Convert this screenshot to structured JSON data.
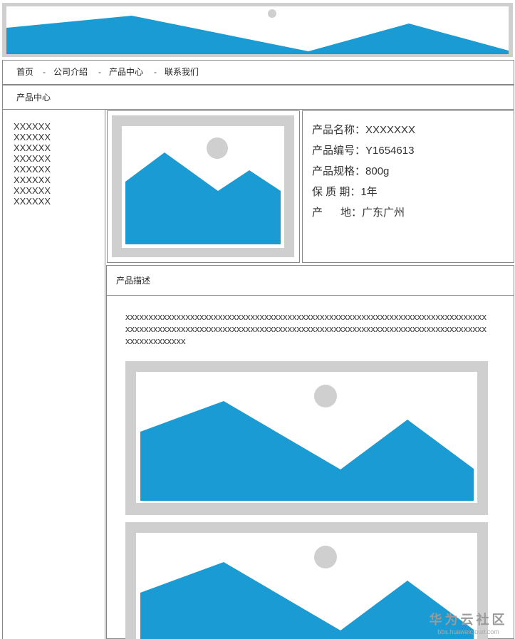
{
  "nav": {
    "items": [
      "首页",
      "公司介绍",
      "产品中心",
      "联系我们"
    ],
    "separator": "-"
  },
  "breadcrumb": {
    "label": "产品中心"
  },
  "sidebar": {
    "items": [
      "XXXXXX",
      "XXXXXX",
      "XXXXXX",
      "XXXXXX",
      "XXXXXX",
      "XXXXXX",
      "XXXXXX",
      "XXXXXX"
    ]
  },
  "product": {
    "name_label": "产品名称：",
    "name": "XXXXXXX",
    "code_label": "产品编号：",
    "code": "Y1654613",
    "spec_label": "产品规格：",
    "spec": "800g",
    "shelf_label": "保 质 期：",
    "shelf": "1年",
    "origin_label": "产      地：",
    "origin": "广东广州"
  },
  "description": {
    "heading": "产品描述",
    "text": "xxxxxxxxxxxxxxxxxxxxxxxxxxxxxxxxxxxxxxxxxxxxxxxxxxxxxxxxxxxxxxxxxxxxxxxxxxxxxxxxxxxxxxxxxxxxxxxxxxxxxxxxxxxxxxxxxxxxxxxxxxxxxxxxxxxxxxxxxxxxxxxxxxxxxxxxxxxxxxxxxxxxxxxxx"
  },
  "watermark": {
    "title": "华为云社区",
    "url": "bbs.huaweicloud.com"
  },
  "colors": {
    "placeholder_blue": "#1b9bd4",
    "placeholder_gray": "#cfcfcf",
    "border": "#888888"
  }
}
